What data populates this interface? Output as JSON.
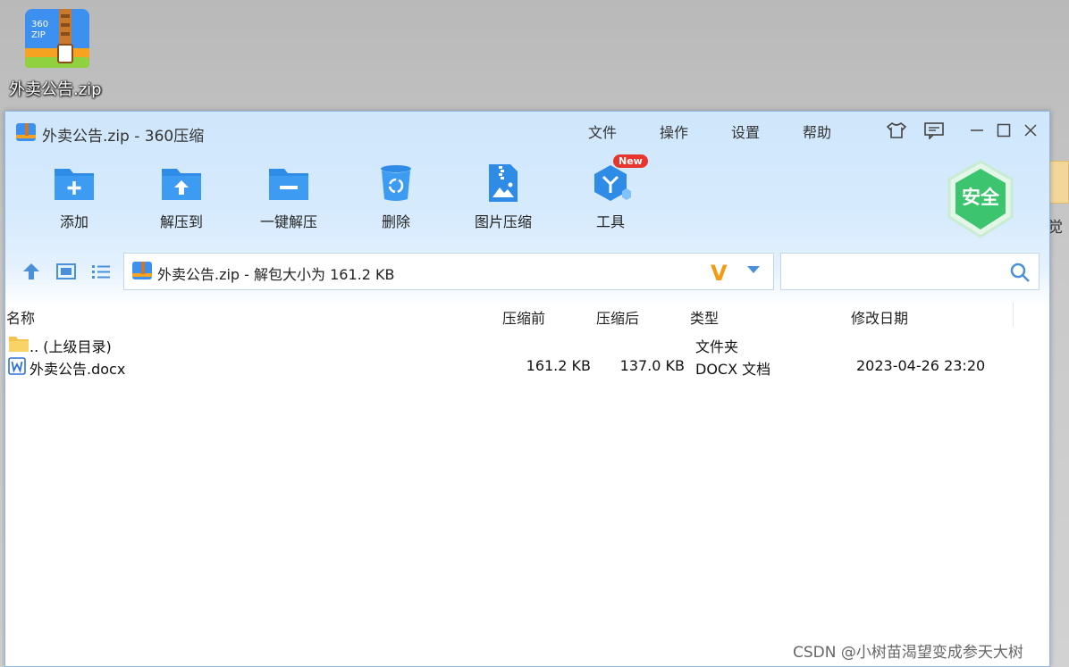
{
  "desktop": {
    "icon_label": "外卖公告.zip",
    "right_edge_text": "觉"
  },
  "window": {
    "title": "外卖公告.zip - 360压缩",
    "menu": [
      "文件",
      "操作",
      "设置",
      "帮助"
    ],
    "controls": [
      "skin-icon",
      "feedback-icon",
      "minimize-icon",
      "maximize-icon",
      "close-icon"
    ]
  },
  "toolbar": {
    "add": "添加",
    "extract_to": "解压到",
    "one_click_extract": "一键解压",
    "delete": "删除",
    "image_compress": "图片压缩",
    "tools": "工具",
    "new_badge": "New",
    "safe_badge": "安全"
  },
  "address": {
    "path": "外卖公告.zip - 解包大小为 161.2 KB",
    "v_mark": "V",
    "search_placeholder": ""
  },
  "columns": {
    "name": "名称",
    "compressed_before": "压缩前",
    "compressed_after": "压缩后",
    "type": "类型",
    "modified": "修改日期"
  },
  "rows": [
    {
      "name": ".. (上级目录)",
      "before": "",
      "after": "",
      "type": "文件夹",
      "modified": ""
    },
    {
      "name": "外卖公告.docx",
      "before": "161.2 KB",
      "after": "137.0 KB",
      "type": "DOCX 文档",
      "modified": "2023-04-26 23:20"
    }
  ],
  "watermark": "CSDN @小树苗渴望变成参天大树",
  "colors": {
    "accent_blue": "#2e8ce6",
    "badge_red": "#e8362f",
    "safe_green": "#3cc46e",
    "v_orange": "#f39c12"
  }
}
